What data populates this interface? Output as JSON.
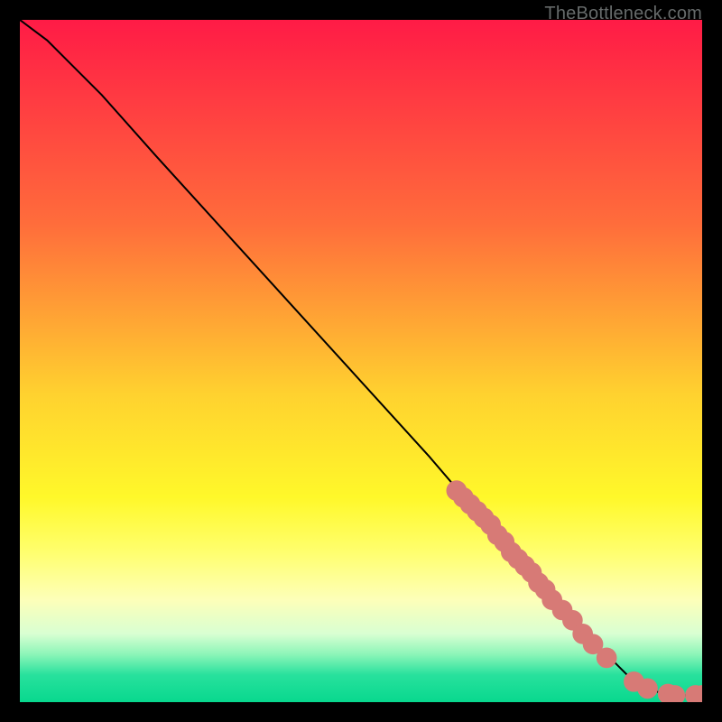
{
  "watermark": "TheBottleneck.com",
  "colors": {
    "dot": "#d77a76",
    "line": "#000000",
    "frame": "#000000"
  },
  "gradient_stops": [
    {
      "offset": 0,
      "color": "#ff1b46"
    },
    {
      "offset": 30,
      "color": "#ff6d3b"
    },
    {
      "offset": 55,
      "color": "#ffd22f"
    },
    {
      "offset": 70,
      "color": "#fff82a"
    },
    {
      "offset": 78,
      "color": "#ffff6e"
    },
    {
      "offset": 85,
      "color": "#fdffb9"
    },
    {
      "offset": 90,
      "color": "#d8ffd2"
    },
    {
      "offset": 93,
      "color": "#8cf5b8"
    },
    {
      "offset": 96,
      "color": "#28e19d"
    },
    {
      "offset": 100,
      "color": "#08d88e"
    }
  ],
  "chart_data": {
    "type": "line",
    "title": "",
    "xlabel": "",
    "ylabel": "",
    "xlim": [
      0,
      100
    ],
    "ylim": [
      0,
      100
    ],
    "series": [
      {
        "name": "curve",
        "x": [
          0,
          4,
          8,
          12,
          20,
          30,
          40,
          50,
          60,
          66,
          70,
          74,
          78,
          82,
          85,
          88,
          90,
          92,
          95,
          98,
          100
        ],
        "y": [
          100,
          97,
          93,
          89,
          80,
          69,
          58,
          47,
          36,
          29,
          25,
          20,
          15,
          11,
          8,
          5,
          3,
          2,
          1,
          1,
          1
        ]
      }
    ],
    "points": [
      {
        "x": 64,
        "y": 31
      },
      {
        "x": 65,
        "y": 30
      },
      {
        "x": 66,
        "y": 29
      },
      {
        "x": 67,
        "y": 28
      },
      {
        "x": 68,
        "y": 27
      },
      {
        "x": 69,
        "y": 26
      },
      {
        "x": 70,
        "y": 24.5
      },
      {
        "x": 71,
        "y": 23.5
      },
      {
        "x": 72,
        "y": 22
      },
      {
        "x": 73,
        "y": 21
      },
      {
        "x": 74,
        "y": 20
      },
      {
        "x": 75,
        "y": 19
      },
      {
        "x": 76,
        "y": 17.5
      },
      {
        "x": 77,
        "y": 16.5
      },
      {
        "x": 78,
        "y": 15
      },
      {
        "x": 79.5,
        "y": 13.5
      },
      {
        "x": 81,
        "y": 12
      },
      {
        "x": 82.5,
        "y": 10
      },
      {
        "x": 84,
        "y": 8.5
      },
      {
        "x": 86,
        "y": 6.5
      },
      {
        "x": 90,
        "y": 3
      },
      {
        "x": 92,
        "y": 2
      },
      {
        "x": 95,
        "y": 1.2
      },
      {
        "x": 96,
        "y": 1
      },
      {
        "x": 99,
        "y": 1
      },
      {
        "x": 100,
        "y": 1
      }
    ]
  }
}
